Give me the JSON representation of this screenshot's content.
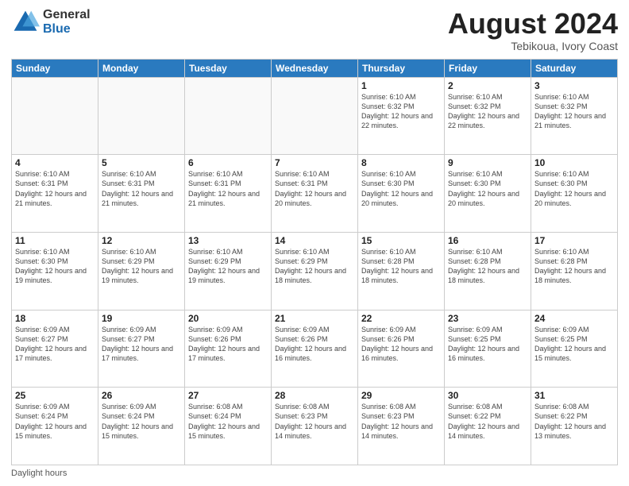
{
  "logo": {
    "general": "General",
    "blue": "Blue"
  },
  "title": {
    "month_year": "August 2024",
    "location": "Tebikoua, Ivory Coast"
  },
  "weekdays": [
    "Sunday",
    "Monday",
    "Tuesday",
    "Wednesday",
    "Thursday",
    "Friday",
    "Saturday"
  ],
  "weeks": [
    [
      {
        "day": "",
        "info": ""
      },
      {
        "day": "",
        "info": ""
      },
      {
        "day": "",
        "info": ""
      },
      {
        "day": "",
        "info": ""
      },
      {
        "day": "1",
        "info": "Sunrise: 6:10 AM\nSunset: 6:32 PM\nDaylight: 12 hours and 22 minutes."
      },
      {
        "day": "2",
        "info": "Sunrise: 6:10 AM\nSunset: 6:32 PM\nDaylight: 12 hours and 22 minutes."
      },
      {
        "day": "3",
        "info": "Sunrise: 6:10 AM\nSunset: 6:32 PM\nDaylight: 12 hours and 21 minutes."
      }
    ],
    [
      {
        "day": "4",
        "info": "Sunrise: 6:10 AM\nSunset: 6:31 PM\nDaylight: 12 hours and 21 minutes."
      },
      {
        "day": "5",
        "info": "Sunrise: 6:10 AM\nSunset: 6:31 PM\nDaylight: 12 hours and 21 minutes."
      },
      {
        "day": "6",
        "info": "Sunrise: 6:10 AM\nSunset: 6:31 PM\nDaylight: 12 hours and 21 minutes."
      },
      {
        "day": "7",
        "info": "Sunrise: 6:10 AM\nSunset: 6:31 PM\nDaylight: 12 hours and 20 minutes."
      },
      {
        "day": "8",
        "info": "Sunrise: 6:10 AM\nSunset: 6:30 PM\nDaylight: 12 hours and 20 minutes."
      },
      {
        "day": "9",
        "info": "Sunrise: 6:10 AM\nSunset: 6:30 PM\nDaylight: 12 hours and 20 minutes."
      },
      {
        "day": "10",
        "info": "Sunrise: 6:10 AM\nSunset: 6:30 PM\nDaylight: 12 hours and 20 minutes."
      }
    ],
    [
      {
        "day": "11",
        "info": "Sunrise: 6:10 AM\nSunset: 6:30 PM\nDaylight: 12 hours and 19 minutes."
      },
      {
        "day": "12",
        "info": "Sunrise: 6:10 AM\nSunset: 6:29 PM\nDaylight: 12 hours and 19 minutes."
      },
      {
        "day": "13",
        "info": "Sunrise: 6:10 AM\nSunset: 6:29 PM\nDaylight: 12 hours and 19 minutes."
      },
      {
        "day": "14",
        "info": "Sunrise: 6:10 AM\nSunset: 6:29 PM\nDaylight: 12 hours and 18 minutes."
      },
      {
        "day": "15",
        "info": "Sunrise: 6:10 AM\nSunset: 6:28 PM\nDaylight: 12 hours and 18 minutes."
      },
      {
        "day": "16",
        "info": "Sunrise: 6:10 AM\nSunset: 6:28 PM\nDaylight: 12 hours and 18 minutes."
      },
      {
        "day": "17",
        "info": "Sunrise: 6:10 AM\nSunset: 6:28 PM\nDaylight: 12 hours and 18 minutes."
      }
    ],
    [
      {
        "day": "18",
        "info": "Sunrise: 6:09 AM\nSunset: 6:27 PM\nDaylight: 12 hours and 17 minutes."
      },
      {
        "day": "19",
        "info": "Sunrise: 6:09 AM\nSunset: 6:27 PM\nDaylight: 12 hours and 17 minutes."
      },
      {
        "day": "20",
        "info": "Sunrise: 6:09 AM\nSunset: 6:26 PM\nDaylight: 12 hours and 17 minutes."
      },
      {
        "day": "21",
        "info": "Sunrise: 6:09 AM\nSunset: 6:26 PM\nDaylight: 12 hours and 16 minutes."
      },
      {
        "day": "22",
        "info": "Sunrise: 6:09 AM\nSunset: 6:26 PM\nDaylight: 12 hours and 16 minutes."
      },
      {
        "day": "23",
        "info": "Sunrise: 6:09 AM\nSunset: 6:25 PM\nDaylight: 12 hours and 16 minutes."
      },
      {
        "day": "24",
        "info": "Sunrise: 6:09 AM\nSunset: 6:25 PM\nDaylight: 12 hours and 15 minutes."
      }
    ],
    [
      {
        "day": "25",
        "info": "Sunrise: 6:09 AM\nSunset: 6:24 PM\nDaylight: 12 hours and 15 minutes."
      },
      {
        "day": "26",
        "info": "Sunrise: 6:09 AM\nSunset: 6:24 PM\nDaylight: 12 hours and 15 minutes."
      },
      {
        "day": "27",
        "info": "Sunrise: 6:08 AM\nSunset: 6:24 PM\nDaylight: 12 hours and 15 minutes."
      },
      {
        "day": "28",
        "info": "Sunrise: 6:08 AM\nSunset: 6:23 PM\nDaylight: 12 hours and 14 minutes."
      },
      {
        "day": "29",
        "info": "Sunrise: 6:08 AM\nSunset: 6:23 PM\nDaylight: 12 hours and 14 minutes."
      },
      {
        "day": "30",
        "info": "Sunrise: 6:08 AM\nSunset: 6:22 PM\nDaylight: 12 hours and 14 minutes."
      },
      {
        "day": "31",
        "info": "Sunrise: 6:08 AM\nSunset: 6:22 PM\nDaylight: 12 hours and 13 minutes."
      }
    ]
  ],
  "legend": {
    "daylight_hours": "Daylight hours"
  }
}
